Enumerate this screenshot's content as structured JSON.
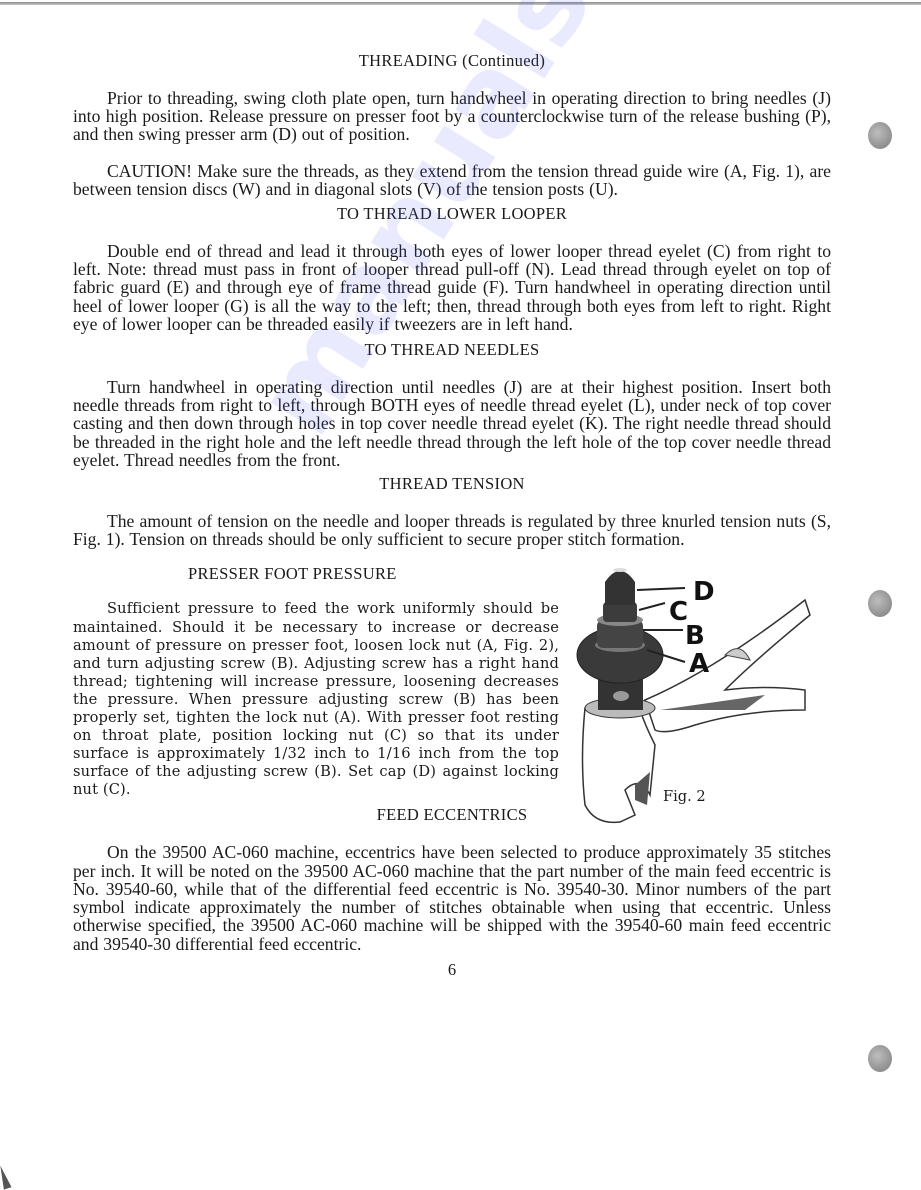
{
  "page": {
    "number": "6",
    "section_title": "THREADING (Continued)"
  },
  "sections": {
    "intro": {
      "paragraph": "Prior to threading, swing cloth plate open, turn handwheel in operating direction to bring needles (J) into high position. Release pressure on presser foot by a counterclockwise turn of the release bushing (P), and then swing presser arm (D) out of position."
    },
    "caution": {
      "paragraph": "CAUTION! Make sure the threads, as they extend from the tension thread guide wire (A, Fig. 1), are between tension discs (W) and in diagonal slots (V) of the tension posts (U)."
    },
    "lower_looper": {
      "heading": "TO THREAD LOWER LOOPER",
      "paragraph": "Double end of thread and lead it through both eyes of lower looper thread eyelet (C) from right to left. Note: thread must pass in front of looper thread pull-off (N). Lead thread through eyelet on top of fabric guard (E) and through eye of frame thread guide (F). Turn handwheel in operating direction until heel of lower looper (G) is all the way to the left; then, thread through both eyes from left to right. Right eye of lower looper can be threaded easily if tweezers are in left hand."
    },
    "needles": {
      "heading": "TO THREAD NEEDLES",
      "paragraph": "Turn handwheel in operating direction until needles (J) are at their highest position. Insert both needle threads from right to left, through BOTH eyes of needle thread eyelet (L), under neck of top cover casting and then down through holes in top cover needle thread eyelet (K). The right needle thread should be threaded in the right hole and the left needle thread through the left hole of the top cover needle thread eyelet. Thread needles from the front."
    },
    "tension": {
      "heading": "THREAD TENSION",
      "paragraph": "The amount of tension on the needle and looper threads is regulated by three knurled tension nuts (S, Fig. 1). Tension on threads should be only sufficient to secure proper stitch formation."
    },
    "presser_foot": {
      "heading": "PRESSER FOOT PRESSURE",
      "paragraph": "Sufficient pressure to feed the work uniformly should be maintained. Should it be necessary to increase or decrease amount of pressure on presser foot, loosen lock nut (A, Fig. 2), and turn adjusting screw (B). Adjusting screw has a right hand thread; tightening will increase pressure, loosening decreases the pressure. When pressure adjusting screw (B) has been properly set, tighten the lock nut (A). With presser foot resting on throat plate, position locking nut (C) so that its under surface is approximately 1/32 inch to 1/16 inch from the top surface of the adjusting screw (B). Set cap (D) against locking nut (C).",
      "figure": {
        "caption": "Fig. 2",
        "labels": [
          "D",
          "C",
          "B",
          "A"
        ]
      }
    },
    "feed_eccentrics": {
      "heading": "FEED ECCENTRICS",
      "paragraph": "On the 39500 AC-060 machine, eccentrics have been selected to produce approximately 35 stitches per inch. It will be noted on the 39500 AC-060 machine that the part number of the main feed eccentric is No. 39540-60, while that of the differential feed eccentric is No. 39540-30. Minor numbers of the part symbol indicate approximately the number of stitches obtainable when using that eccentric. Unless otherwise specified, the 39500 AC-060 machine will be shipped with the 39540-60 main feed eccentric and 39540-30 differential feed eccentric."
    }
  },
  "watermark": "manualslib.com"
}
